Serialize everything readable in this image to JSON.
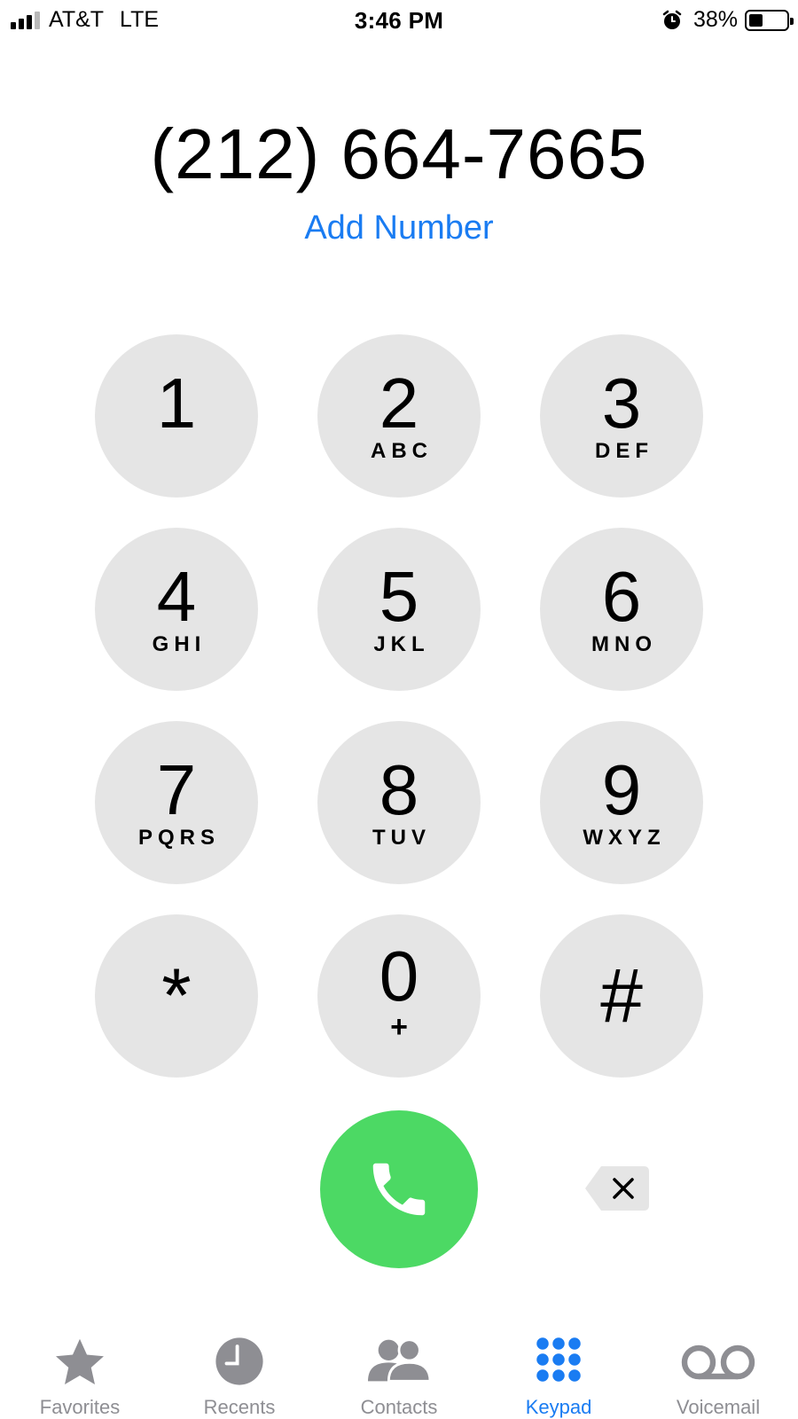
{
  "status_bar": {
    "carrier": "AT&T",
    "network": "LTE",
    "time": "3:46 PM",
    "battery_percent": "38%",
    "battery_level": 0.38,
    "signal_bars": 3,
    "signal_bars_total": 4,
    "alarm_icon": "alarm-clock-icon"
  },
  "dialer": {
    "number": "(212) 664-7665",
    "add_number_label": "Add Number"
  },
  "keypad": {
    "keys": [
      {
        "digit": "1",
        "letters": ""
      },
      {
        "digit": "2",
        "letters": "ABC"
      },
      {
        "digit": "3",
        "letters": "DEF"
      },
      {
        "digit": "4",
        "letters": "GHI"
      },
      {
        "digit": "5",
        "letters": "JKL"
      },
      {
        "digit": "6",
        "letters": "MNO"
      },
      {
        "digit": "7",
        "letters": "PQRS"
      },
      {
        "digit": "8",
        "letters": "TUV"
      },
      {
        "digit": "9",
        "letters": "WXYZ"
      },
      {
        "digit": "*",
        "letters": ""
      },
      {
        "digit": "0",
        "letters": "+"
      },
      {
        "digit": "#",
        "letters": ""
      }
    ],
    "key_color": "#e5e5e5"
  },
  "actions": {
    "call_icon": "phone-icon",
    "call_color": "#4cd964",
    "delete_icon": "backspace-icon"
  },
  "tab_bar": {
    "active_color": "#1a7cf2",
    "inactive_color": "#8e8e93",
    "tabs": [
      {
        "label": "Favorites",
        "icon": "star-icon",
        "active": false
      },
      {
        "label": "Recents",
        "icon": "clock-icon",
        "active": false
      },
      {
        "label": "Contacts",
        "icon": "contacts-icon",
        "active": false
      },
      {
        "label": "Keypad",
        "icon": "keypad-icon",
        "active": true
      },
      {
        "label": "Voicemail",
        "icon": "voicemail-icon",
        "active": false
      }
    ]
  }
}
